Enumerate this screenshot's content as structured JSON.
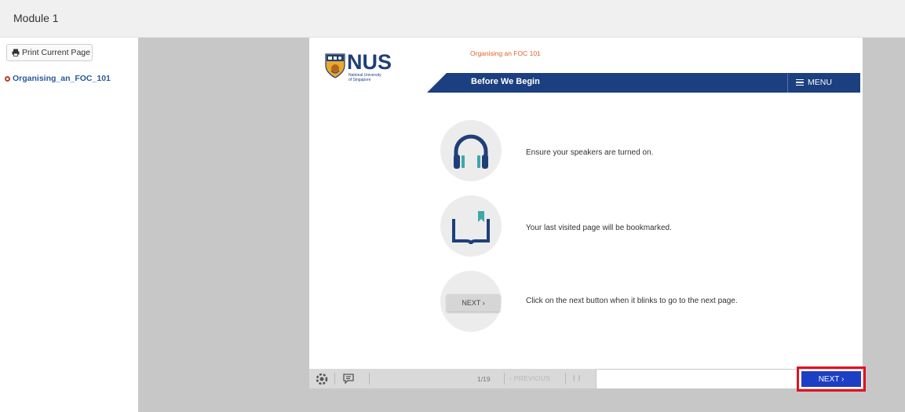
{
  "window": {
    "title": "Module 1"
  },
  "sidebar": {
    "print_button": "Print Current Page",
    "tree": [
      {
        "label": "Organising_an_FOC_101"
      }
    ]
  },
  "header": {
    "logo_text": "NUS",
    "logo_sub1": "National University",
    "logo_sub2": "of Singapore",
    "course_title": "Organising an FOC 101",
    "page_title": "Before We Begin",
    "menu_label": "MENU"
  },
  "steps": [
    {
      "icon": "headphones-icon",
      "text": "Ensure your speakers are turned on."
    },
    {
      "icon": "book-bookmark-icon",
      "text": "Your last visited page will be bookmarked."
    },
    {
      "icon": "next-button-icon",
      "icon_label": "NEXT ›",
      "text": "Click on the next button when it blinks to go to the next page."
    }
  ],
  "controls": {
    "page_counter": "1/19",
    "previous_label": "‹ PREVIOUS",
    "pause_label": "❙❙",
    "next_label": "NEXT ›"
  },
  "colors": {
    "brand_blue": "#1c3f80",
    "next_blue": "#1c3fc4",
    "course_title_orange": "#e0622a",
    "highlight_red": "#e0141e",
    "icon_teal": "#3ea7a8",
    "icon_navy": "#1f3f7a"
  }
}
